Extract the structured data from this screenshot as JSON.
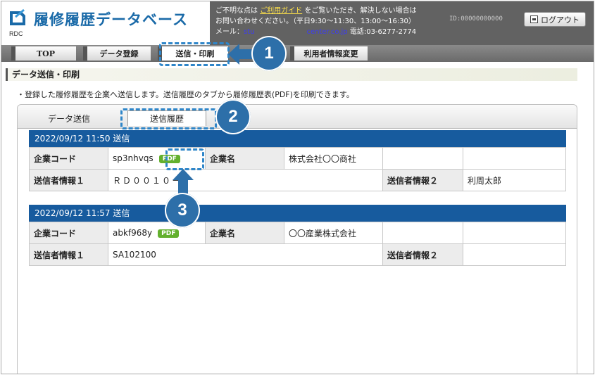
{
  "header": {
    "title": "履修履歴データベース",
    "logo_sub": "RDC",
    "notice_line1_a": "ご不明な点は",
    "guide_link": "ご利用ガイド",
    "notice_line1_b": "をご覧いただき、解決しない場合は",
    "notice_line2": "お問い合わせください。（平日9:30～11:30、13:00～16:30）",
    "mail_label": "メール：",
    "mail_visible_a": "stu",
    "mail_visible_b": "center.co.jp",
    "phone": "電話:03-6277-2774",
    "user_id": "ID:00000000000",
    "logout_label": "ログアウト"
  },
  "nav": {
    "items": [
      {
        "label": "TOP"
      },
      {
        "label": "データ登録"
      },
      {
        "label": "送信・印刷"
      },
      {
        "label": "利用者情報変更"
      }
    ]
  },
  "section": {
    "title": "データ送信・印刷",
    "description": "・登録した履修履歴を企業へ送信します。送信履歴のタブから履修履歴表(PDF)を印刷できます。"
  },
  "tabs": {
    "send": "データ送信",
    "history": "送信履歴"
  },
  "labels": {
    "company_code": "企業コード",
    "company_name": "企業名",
    "sender1": "送信者情報１",
    "sender2": "送信者情報２",
    "pdf": "PDF"
  },
  "records": [
    {
      "header": "2022/09/12 11:50 送信",
      "company_code": "sp3nhvqs",
      "company_name": "株式会社〇〇商社",
      "sender1": "ＲＤ００１０－",
      "sender2": "利周太郎"
    },
    {
      "header": "2022/09/12 11:57 送信",
      "company_code": "abkf968y",
      "company_name": "〇〇産業株式会社",
      "sender1": "SA102100",
      "sender2": ""
    }
  ],
  "annotations": {
    "step1": "1",
    "step2": "2",
    "step3": "3"
  },
  "colors": {
    "accent": "#2d6fa9",
    "record_header": "#175b9e",
    "pdf_badge": "#63b02e"
  }
}
